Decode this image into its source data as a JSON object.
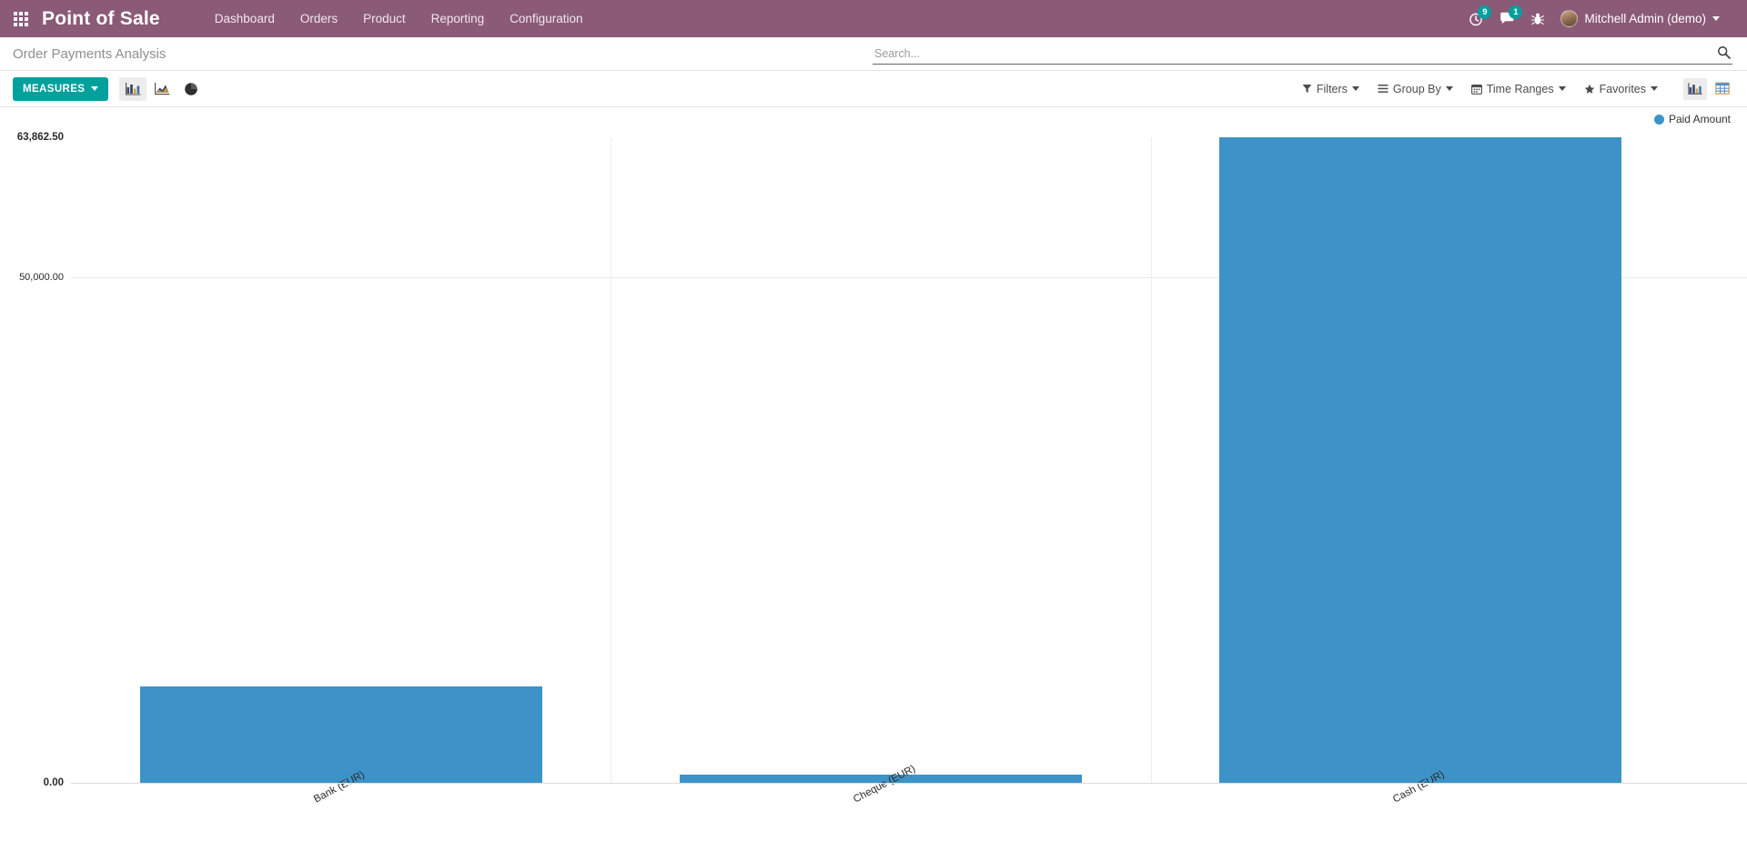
{
  "navbar": {
    "apps_icon": "grid-apps-icon",
    "brand": "Point of Sale",
    "menu": [
      {
        "label": "Dashboard"
      },
      {
        "label": "Orders"
      },
      {
        "label": "Product"
      },
      {
        "label": "Reporting"
      },
      {
        "label": "Configuration"
      }
    ],
    "activities": {
      "icon": "clock-icon",
      "count": "9"
    },
    "messages": {
      "icon": "chat-icon",
      "count": "1"
    },
    "debug": {
      "icon": "bug-icon"
    },
    "user": {
      "name": "Mitchell Admin (demo)",
      "avatar": "user-avatar"
    }
  },
  "control_row": {
    "page_title": "Order Payments Analysis",
    "search": {
      "placeholder": "Search...",
      "value": "",
      "icon": "search-icon"
    }
  },
  "toolbar": {
    "measures_label": "MEASURES",
    "chart_types": [
      {
        "name": "bar-chart-icon",
        "active": true
      },
      {
        "name": "line-chart-icon",
        "active": false
      },
      {
        "name": "pie-chart-icon",
        "active": false
      }
    ],
    "filters": [
      {
        "label": "Filters",
        "icon": "funnel-icon"
      },
      {
        "label": "Group By",
        "icon": "list-icon"
      },
      {
        "label": "Time Ranges",
        "icon": "calendar-icon"
      },
      {
        "label": "Favorites",
        "icon": "star-icon"
      }
    ],
    "views": [
      {
        "name": "graph-view-icon",
        "active": true
      },
      {
        "name": "pivot-view-icon",
        "active": false
      }
    ]
  },
  "chart_data": {
    "type": "bar",
    "title": "Order Payments Analysis",
    "categories": [
      "Bank (EUR)",
      "Cheque (EUR)",
      "Cash (EUR)"
    ],
    "series": [
      {
        "name": "Paid Amount",
        "values": [
          9500.0,
          800.0,
          63862.5
        ],
        "color": "#3d93c8"
      }
    ],
    "legend": [
      "Paid Amount"
    ],
    "legend_position": "top-right",
    "ytick_labels": [
      "63,862.50",
      "50,000.00",
      "0.00"
    ],
    "ytick_values": [
      63862.5,
      50000.0,
      0.0
    ],
    "ylim": [
      0,
      63862.5
    ],
    "xlabel": "",
    "ylabel": "",
    "grid": true
  }
}
